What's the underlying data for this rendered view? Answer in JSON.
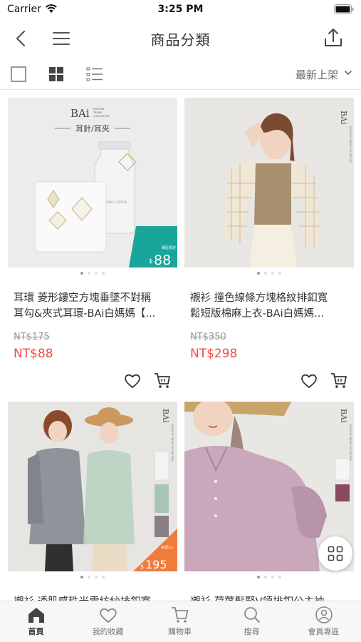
{
  "status_bar": {
    "carrier": "Carrier",
    "time": "3:25 PM"
  },
  "nav": {
    "title": "商品分類"
  },
  "toolbar": {
    "sort_label": "最新上架"
  },
  "products": [
    {
      "title_line1": "耳環 菱形鏤空方塊垂墜不對稱",
      "title_line2": "耳勾&夾式耳環-BAi白媽媽【...",
      "old_price": "NT$175",
      "price": "NT$88",
      "image": {
        "brand": "BAi",
        "brand_sub1": "FASHION",
        "brand_sub2": "TREND",
        "brand_sub3": "COLLECTION",
        "caption": "耳針/耳夾",
        "jar_label": "MAKING CARTON",
        "badge_text": "專區限定",
        "badge_price": "88",
        "badge_currency": "$",
        "badge_color": "#1aa59a"
      }
    },
    {
      "title_line1": "襯衫 撞色線條方塊格紋排釦寬",
      "title_line2": "鬆短版棉麻上衣-BAi白媽媽...",
      "old_price": "NT$350",
      "price": "NT$298",
      "image": {
        "brand": "BAi",
        "brand_sub": "FASHION TREND COLLECTION"
      }
    },
    {
      "title_line1": "襯衫 透肌感珠光雪紡紗排釦寬",
      "title_line2": "",
      "image": {
        "brand": "BAi",
        "brand_sub": "FASHION TREND COLLECTION",
        "badge_text": "任選2入",
        "badge_price": "195",
        "badge_currency": "$",
        "badge_color": "#f07c3c"
      }
    },
    {
      "title_line1": "襯衫 荷葉鬆緊V領排釦公主袖",
      "title_line2": "",
      "image": {
        "brand": "BAi",
        "brand_sub": "FASHION TREND COLLECTION"
      }
    }
  ],
  "tabs": [
    {
      "label": "首頁",
      "icon": "home-icon",
      "active": true
    },
    {
      "label": "我的收藏",
      "icon": "heart-icon",
      "active": false
    },
    {
      "label": "購物車",
      "icon": "cart-icon",
      "active": false
    },
    {
      "label": "搜尋",
      "icon": "search-icon",
      "active": false
    },
    {
      "label": "會員專區",
      "icon": "member-icon",
      "active": false
    }
  ],
  "colors": {
    "price_red": "#f04b4b",
    "teal_badge": "#1aa59a",
    "orange_badge": "#f07c3c"
  }
}
